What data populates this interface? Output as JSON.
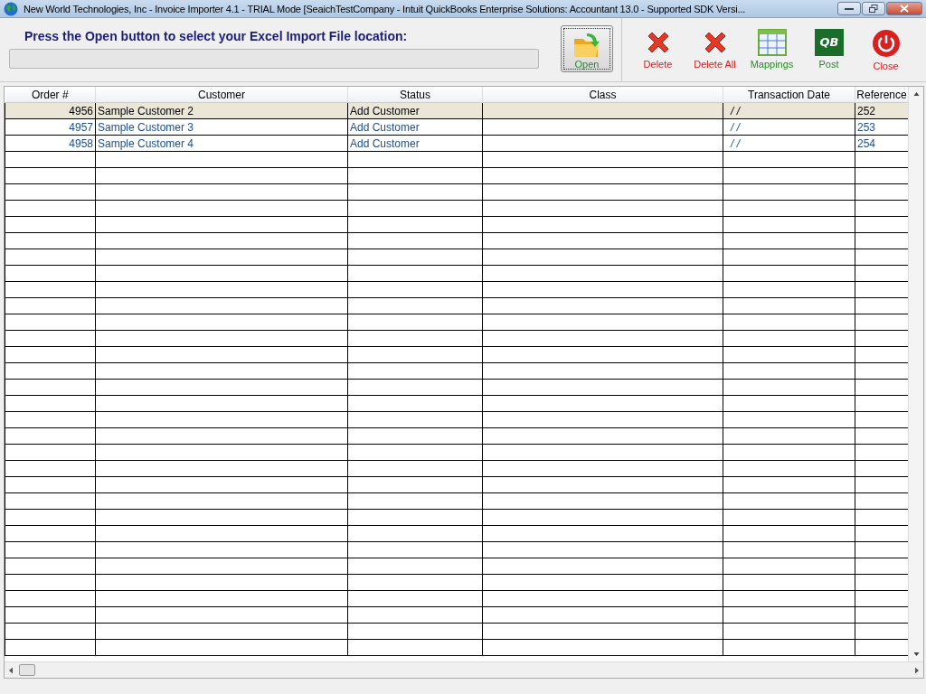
{
  "window": {
    "title": "New World Technologies, Inc - Invoice Importer 4.1 - TRIAL Mode    [SeaichTestCompany - Intuit QuickBooks Enterprise Solutions: Accountant 13.0 - Supported SDK Versi..."
  },
  "prompt": {
    "label": "Press the Open button to select your Excel Import File location:"
  },
  "toolbar": [
    {
      "kind": "open",
      "label": "Open"
    },
    {
      "kind": "delete",
      "label": "Delete"
    },
    {
      "kind": "delete",
      "label": "Delete All"
    },
    {
      "kind": "mappings",
      "label": "Mappings"
    },
    {
      "kind": "post",
      "label": "Post",
      "logo_text": "QB"
    },
    {
      "kind": "close",
      "label": "Close"
    }
  ],
  "table": {
    "columns": [
      "Order #",
      "Customer",
      "Status",
      "Class",
      "Transaction Date",
      "Reference"
    ],
    "rows": [
      {
        "selected": true,
        "cells": [
          "4956",
          "Sample Customer 2",
          "Add Customer",
          "",
          "/ /",
          "252"
        ]
      },
      {
        "selected": false,
        "cells": [
          "4957",
          "Sample Customer 3",
          "Add Customer",
          "",
          "/ /",
          "253"
        ]
      },
      {
        "selected": false,
        "cells": [
          "4958",
          "Sample Customer 4",
          "Add Customer",
          "",
          "/ /",
          "254"
        ]
      }
    ]
  }
}
